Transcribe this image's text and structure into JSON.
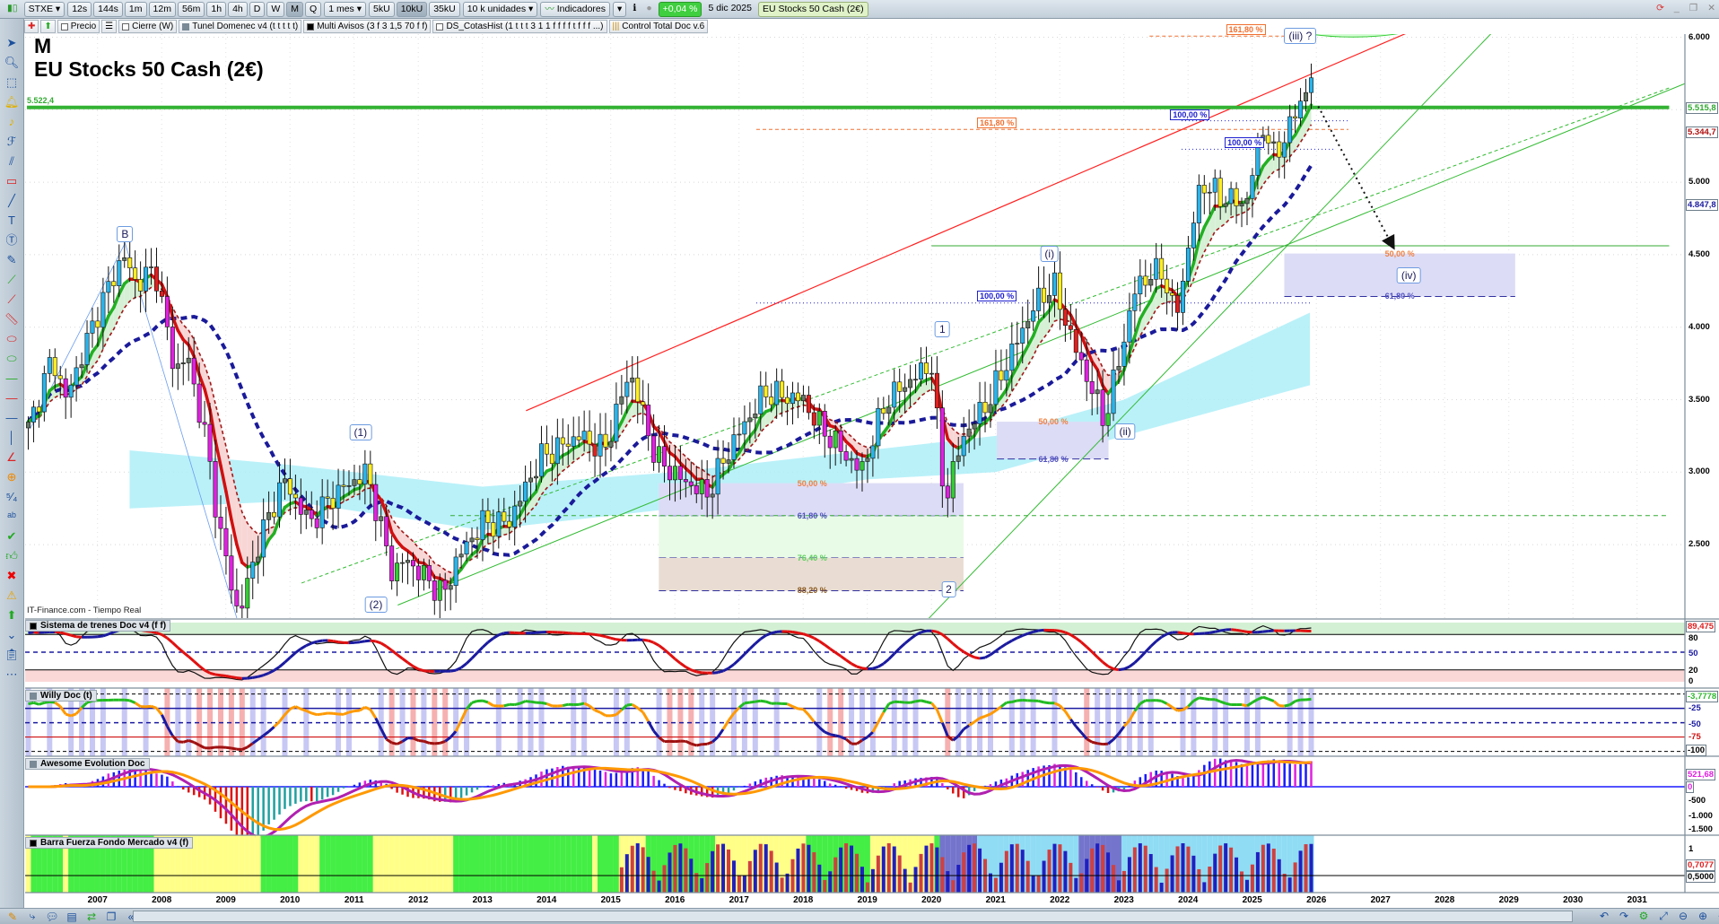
{
  "toolbar": {
    "symbol": "STXE",
    "timeframes": [
      "12s",
      "144s",
      "1m",
      "12m",
      "56m",
      "1h",
      "4h",
      "D",
      "W",
      "M",
      "Q"
    ],
    "active_timeframe": "M",
    "period": "1 mes",
    "units": [
      "5kU",
      "10kU",
      "35kU"
    ],
    "active_unit": "10kU",
    "units_select": "10 k unidades",
    "indicators_label": "Indicadores",
    "change": "+0,04 %",
    "date": "5 dic 2025",
    "instrument": "EU Stocks 50 Cash (2€)"
  },
  "chips": [
    "Precio",
    "Cierre (W)",
    "Tunel Domenec v4 (t t t t t)",
    "Multi Avisos (3 f 3 1,5 70 f f)",
    "DS_CotasHist (1 t t t 3 1 1 f f f f t f f f ...)",
    "Control Total Doc v.6"
  ],
  "chart": {
    "period_label": "M",
    "name": "EU Stocks 50 Cash (2€)",
    "last_price_label": "5.522,4",
    "source": "IT-Finance.com - Tiempo Real"
  },
  "panes": {
    "sistema": "Sistema de trenes Doc v4 (f f)",
    "willy": "Willy Doc (t)",
    "awesome": "Awesome Evolution Doc",
    "barra": "Barra Fuerza Fondo Mercado v4 (f)"
  },
  "axis": {
    "price_ticks": [
      {
        "v": 6000,
        "t": "6.000"
      },
      {
        "v": 5000,
        "t": "5.000"
      },
      {
        "v": 4500,
        "t": "4.500"
      },
      {
        "v": 4000,
        "t": "4.000"
      },
      {
        "v": 3500,
        "t": "3.500"
      },
      {
        "v": 3000,
        "t": "3.000"
      },
      {
        "v": 2500,
        "t": "2.500"
      }
    ],
    "price_badges": [
      {
        "v": 5515.8,
        "t": "5.515,8",
        "color": "#2fa82f"
      },
      {
        "v": 5344.7,
        "t": "5.344,7",
        "color": "#b01010"
      },
      {
        "v": 4847.8,
        "t": "4.847,8",
        "color": "#1a1aa0"
      }
    ],
    "sistema_labels": [
      {
        "t": "89,475",
        "color": "#e02020",
        "box": true
      },
      {
        "t": "80"
      },
      {
        "t": "50",
        "color": "#1a1aa0"
      },
      {
        "t": "20"
      },
      {
        "t": "0"
      }
    ],
    "willy_labels": [
      {
        "t": "-3,7778",
        "color": "#2fb82f",
        "box": true
      },
      {
        "t": "-25",
        "color": "#1a1aa0"
      },
      {
        "t": "-50",
        "color": "#1a1aa0"
      },
      {
        "t": "-75",
        "color": "#d01010"
      },
      {
        "t": "-100",
        "box": true
      }
    ],
    "awesome_labels": [
      {
        "t": "521,68",
        "color": "#e020e0",
        "box": true
      },
      {
        "t": "0",
        "color": "#e020e0",
        "box": true
      },
      {
        "t": "-500"
      },
      {
        "t": "-1.000"
      },
      {
        "t": "-1.500"
      }
    ],
    "barra_labels": [
      {
        "t": "1"
      },
      {
        "t": "0,7077",
        "color": "#e02020",
        "box": true
      },
      {
        "t": "0,5000",
        "box": true
      }
    ],
    "years": [
      "2007",
      "2008",
      "2009",
      "2010",
      "2011",
      "2012",
      "2013",
      "2014",
      "2015",
      "2016",
      "2017",
      "2018",
      "2019",
      "2020",
      "2021",
      "2022",
      "2023",
      "2024",
      "2025",
      "2026",
      "2027",
      "2028",
      "2029",
      "2030",
      "2031"
    ]
  },
  "chart_data": {
    "type": "candlestick",
    "interval": "monthly",
    "title": "EU Stocks 50 Cash (2€)",
    "ylim": [
      2000,
      6200
    ],
    "xlim": [
      2005.9,
      2031.5
    ],
    "close_anchors": [
      [
        2005.92,
        3300
      ],
      [
        2006.3,
        3800
      ],
      [
        2006.5,
        3500
      ],
      [
        2007.0,
        4100
      ],
      [
        2007.4,
        4500
      ],
      [
        2007.6,
        4300
      ],
      [
        2007.9,
        4400
      ],
      [
        2008.2,
        3700
      ],
      [
        2008.4,
        3800
      ],
      [
        2008.7,
        3200
      ],
      [
        2008.9,
        2600
      ],
      [
        2009.2,
        2000
      ],
      [
        2009.5,
        2500
      ],
      [
        2009.9,
        2950
      ],
      [
        2010.3,
        2650
      ],
      [
        2010.7,
        2850
      ],
      [
        2011.2,
        3000
      ],
      [
        2011.6,
        2300
      ],
      [
        2011.8,
        2400
      ],
      [
        2012.4,
        2150
      ],
      [
        2012.6,
        2400
      ],
      [
        2013.0,
        2650
      ],
      [
        2013.4,
        2650
      ],
      [
        2013.9,
        3100
      ],
      [
        2014.5,
        3250
      ],
      [
        2014.9,
        3150
      ],
      [
        2015.3,
        3700
      ],
      [
        2015.7,
        3100
      ],
      [
        2016.1,
        2950
      ],
      [
        2016.5,
        2850
      ],
      [
        2016.9,
        3200
      ],
      [
        2017.4,
        3550
      ],
      [
        2018.0,
        3500
      ],
      [
        2018.2,
        3350
      ],
      [
        2018.9,
        3000
      ],
      [
        2019.3,
        3500
      ],
      [
        2020.0,
        3750
      ],
      [
        2020.2,
        2800
      ],
      [
        2020.5,
        3250
      ],
      [
        2020.9,
        3500
      ],
      [
        2021.6,
        4150
      ],
      [
        2021.9,
        4300
      ],
      [
        2022.2,
        3900
      ],
      [
        2022.7,
        3350
      ],
      [
        2023.2,
        4300
      ],
      [
        2023.6,
        4400
      ],
      [
        2023.8,
        4050
      ],
      [
        2024.2,
        5000
      ],
      [
        2024.5,
        4900
      ],
      [
        2024.9,
        4850
      ],
      [
        2025.2,
        5450
      ],
      [
        2025.3,
        5150
      ],
      [
        2025.5,
        5300
      ],
      [
        2025.92,
        5720
      ]
    ],
    "waves": [
      {
        "t": "B",
        "x": 2007.43,
        "y": 4644
      },
      {
        "t": "(1)",
        "x": 2011.1,
        "y": 3273
      },
      {
        "t": "(2)",
        "x": 2011.34,
        "y": 2083
      },
      {
        "t": "1",
        "x": 2020.17,
        "y": 3985
      },
      {
        "t": "2",
        "x": 2020.27,
        "y": 2189
      },
      {
        "t": "(i)",
        "x": 2021.84,
        "y": 4508
      },
      {
        "t": "(ii)",
        "x": 2023.02,
        "y": 3280
      },
      {
        "t": "(iii) ?",
        "x": 2025.75,
        "y": 6008
      },
      {
        "t": "(iv)",
        "x": 2027.44,
        "y": 4356
      }
    ],
    "fib_labels": [
      {
        "t": "161,80 %",
        "x": 2024.9,
        "y": 6053,
        "color": "#f07030",
        "box": true
      },
      {
        "t": "161,80 %",
        "x": 2021.02,
        "y": 5409,
        "color": "#f07030",
        "box": true
      },
      {
        "t": "100,00 %",
        "x": 2024.03,
        "y": 5462,
        "color": "#2020d0",
        "box": true
      },
      {
        "t": "100,00 %",
        "x": 2024.88,
        "y": 5273,
        "color": "#2020d0",
        "box": true
      },
      {
        "t": "100,00 %",
        "x": 2021.02,
        "y": 4212,
        "color": "#2020d0",
        "box": true
      },
      {
        "t": "50,00 %",
        "x": 2018.14,
        "y": 2924,
        "color": "#f08040"
      },
      {
        "t": "61,80 %",
        "x": 2018.14,
        "y": 2697,
        "color": "#5050c0"
      },
      {
        "t": "76,40 %",
        "x": 2018.14,
        "y": 2409,
        "color": "#60d060"
      },
      {
        "t": "88,20 %",
        "x": 2018.14,
        "y": 2182,
        "color": "#8a5a20"
      },
      {
        "t": "50,00 %",
        "x": 2021.9,
        "y": 3348,
        "color": "#f08040"
      },
      {
        "t": "61,80 %",
        "x": 2021.9,
        "y": 3091,
        "color": "#5050c0"
      },
      {
        "t": "50,00 %",
        "x": 2027.3,
        "y": 4508,
        "color": "#f08040"
      },
      {
        "t": "61,80 %",
        "x": 2027.3,
        "y": 4212,
        "color": "#5050c0"
      }
    ],
    "fib_zones": [
      {
        "x0": 2015.75,
        "x1": 2020.5,
        "y0": 2924,
        "y1": 2697,
        "fill": "#dcdcf6"
      },
      {
        "x0": 2015.75,
        "x1": 2020.5,
        "y0": 2697,
        "y1": 2409,
        "fill": "#e8fbe6"
      },
      {
        "x0": 2015.75,
        "x1": 2020.5,
        "y0": 2409,
        "y1": 2182,
        "fill": "#e9ddd3"
      },
      {
        "x0": 2021.02,
        "x1": 2022.76,
        "y0": 3348,
        "y1": 3091,
        "fill": "#dcdcf6"
      },
      {
        "x0": 2025.5,
        "x1": 2029.1,
        "y0": 4508,
        "y1": 4212,
        "fill": "#dcdcf6"
      }
    ],
    "lines": [
      {
        "pts": [
          [
            2013.68,
            3424
          ],
          [
            2027.94,
            6129
          ]
        ],
        "color": "#ff2020",
        "w": 1.2
      },
      {
        "pts": [
          [
            2005.95,
            3300
          ],
          [
            2007.43,
            4580
          ],
          [
            2009.2,
            1950
          ]
        ],
        "color": "#6a9cf0",
        "w": 0.8
      },
      {
        "pts": [
          [
            2010.18,
            2235
          ],
          [
            2031.5,
            5650
          ]
        ],
        "color": "#33bb33",
        "w": 1,
        "dash": "4 3"
      },
      {
        "pts": [
          [
            2011.68,
            2083
          ],
          [
            2031.8,
            5690
          ]
        ],
        "color": "#33bb33",
        "w": 1
      },
      {
        "pts": [
          [
            2019.96,
            1992
          ],
          [
            2028.9,
            6106
          ]
        ],
        "color": "#33bb33",
        "w": 1
      },
      {
        "pts": [
          [
            2020.0,
            4561
          ],
          [
            2031.5,
            4561
          ]
        ],
        "color": "#33aa33",
        "w": 1
      },
      {
        "pts": [
          [
            2012.5,
            2700
          ],
          [
            2031.5,
            2700
          ]
        ],
        "color": "#33aa33",
        "w": 1,
        "dash": "5 4"
      },
      {
        "pts": [
          [
            2005.9,
            5515.8
          ],
          [
            2031.5,
            5515.8
          ]
        ],
        "color": "#33b333",
        "w": 4
      },
      {
        "pts": [
          [
            2023.4,
            6008
          ],
          [
            2025.6,
            6008
          ]
        ],
        "color": "#f07030",
        "w": 1,
        "dash": "4 3"
      },
      {
        "pts": [
          [
            2017.27,
            5364
          ],
          [
            2026.5,
            5364
          ]
        ],
        "color": "#f07030",
        "w": 1,
        "dash": "4 3"
      },
      {
        "pts": [
          [
            2023.9,
            5424
          ],
          [
            2026.5,
            5424
          ]
        ],
        "color": "#2020d0",
        "w": 1,
        "dash": "1 3"
      },
      {
        "pts": [
          [
            2023.9,
            5227
          ],
          [
            2026.3,
            5227
          ]
        ],
        "color": "#2020d0",
        "w": 1,
        "dash": "1 3"
      },
      {
        "pts": [
          [
            2017.27,
            4167
          ],
          [
            2025.9,
            4167
          ]
        ],
        "color": "#2020d0",
        "w": 1,
        "dash": "1 3"
      },
      {
        "pts": [
          [
            2026.03,
            5523
          ],
          [
            2027.17,
            4576
          ]
        ],
        "color": "#111111",
        "w": 2,
        "dash": "2 4",
        "arrow": true
      }
    ]
  },
  "colors": {
    "accent_green": "#33b333",
    "up": "#2ab4ea",
    "down": "#e02020"
  }
}
